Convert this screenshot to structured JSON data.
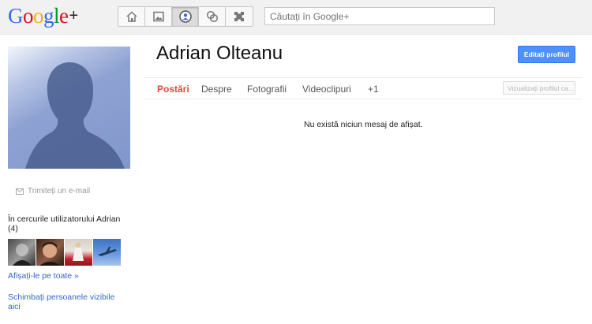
{
  "header": {
    "logo_letters": [
      {
        "ch": "G",
        "color": "#3369e8"
      },
      {
        "ch": "o",
        "color": "#d50f25"
      },
      {
        "ch": "o",
        "color": "#eeb211"
      },
      {
        "ch": "g",
        "color": "#3369e8"
      },
      {
        "ch": "l",
        "color": "#009925"
      },
      {
        "ch": "e",
        "color": "#d50f25"
      }
    ],
    "logo_plus": "+",
    "nav_icons": [
      "home-icon",
      "photos-icon",
      "profile-icon",
      "circles-icon",
      "games-icon"
    ],
    "search_placeholder": "Căutați în Google+"
  },
  "sidebar": {
    "send_email": "Trimiteți un e-mail",
    "circles_title": "În cercurile utilizatorului Adrian (4)",
    "see_all": "Afișați-le pe toate »",
    "change_visible": "Schimbați persoanele vizibile aici"
  },
  "profile": {
    "name": "Adrian Olteanu",
    "edit_button": "Editați profilul",
    "view_as": "Vizualizați profilul ca..."
  },
  "tabs": [
    {
      "label": "Postări",
      "active": true
    },
    {
      "label": "Despre",
      "active": false
    },
    {
      "label": "Fotografii",
      "active": false
    },
    {
      "label": "Videoclipuri",
      "active": false
    },
    {
      "label": "+1",
      "active": false
    }
  ],
  "main": {
    "empty_message": "Nu există niciun mesaj de afișat."
  },
  "colors": {
    "accent_red": "#dd4b39",
    "button_blue": "#4d90fe",
    "link_blue": "#3366cc"
  }
}
